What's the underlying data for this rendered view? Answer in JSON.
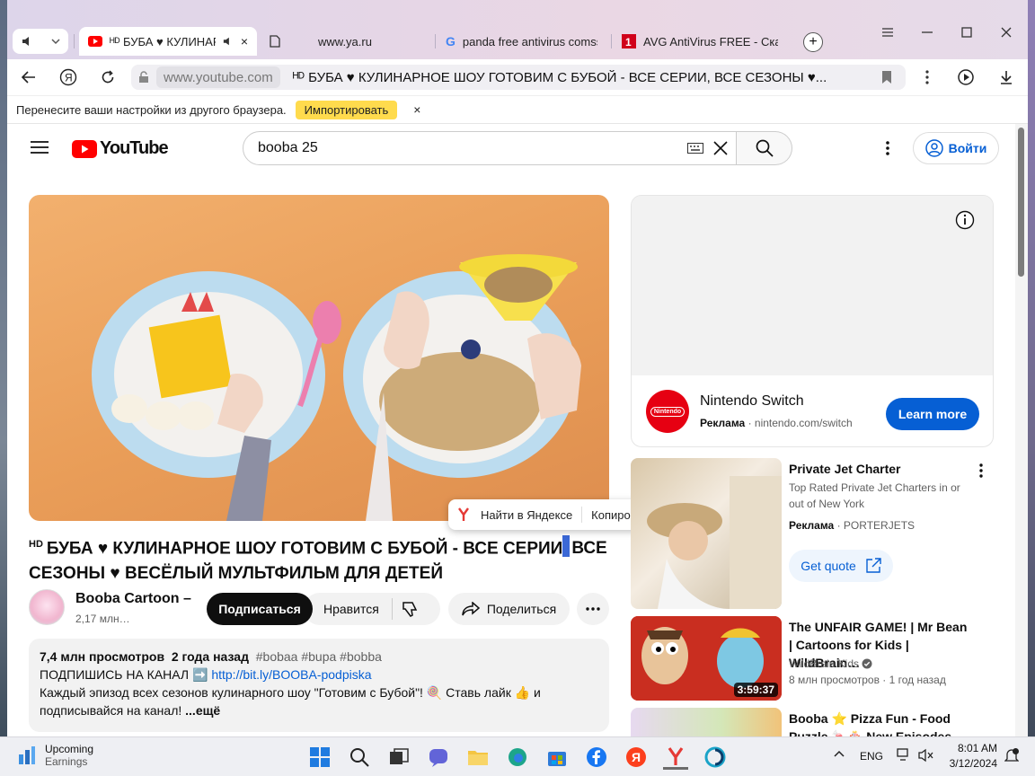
{
  "browser": {
    "tabs": [
      {
        "label": "ᴴᴰ БУБА ♥ КУЛИНАР",
        "favicon": "youtube-icon",
        "active": true
      },
      {
        "label": "www.ya.ru",
        "favicon": "page-icon",
        "active": false
      },
      {
        "label": "panda free antivirus comss",
        "favicon": "google-icon",
        "active": false
      },
      {
        "label": "AVG AntiVirus FREE - Скач",
        "favicon": "avg-icon",
        "active": false
      }
    ],
    "address_domain": "www.youtube.com",
    "address_title": "ᴴᴰ БУБА ♥ КУЛИНАРНОЕ ШОУ ГОТОВИМ С БУБОЙ - ВСЕ СЕРИИ, ВСЕ СЕЗОНЫ ♥...",
    "infobar_text": "Перенесите ваши настройки из другого браузера.",
    "import_label": "Импортировать",
    "close_glyph": "×"
  },
  "youtube": {
    "logo_text": "YouTube",
    "search_query": "booba 25",
    "signin_label": "Войти"
  },
  "video": {
    "hd_badge": "HD",
    "title_part1": "БУБА ♥ КУЛИНАРНОЕ ШОУ ГОТОВИМ С БУБОЙ - ВСЕ СЕРИИ",
    "title_part2": "ВСЕ СЕЗОНЫ ♥ ВЕСЁЛЫЙ МУЛЬТФИЛЬМ ДЛЯ ДЕТЕЙ",
    "selected_char": ","
  },
  "context_popup": {
    "find_label": "Найти в Яндексе",
    "copy_label": "Копировать"
  },
  "channel": {
    "name": "Booba Cartoon –",
    "subs": "2,17 млн…",
    "subscribe_label": "Подписаться",
    "like_label": "Нравится",
    "share_label": "Поделиться"
  },
  "description": {
    "views": "7,4 млн просмотров",
    "age": "2 года назад",
    "tags": "#bobaa #bupa #bobba",
    "line2_prefix": "ПОДПИШИСЬ НА КАНАЛ ➡️",
    "link": "http://bit.ly/BOOBA-podpiska",
    "line3": "Каждый эпизод всех сезонов кулинарного шоу \"Готовим с Бубой\"! 🍭 Ставь лайк 👍 и",
    "line4": "подписывайся на канал!",
    "more_label": "...ещё"
  },
  "ad": {
    "title": "Nintendo Switch",
    "label": "Реклама",
    "url": "nintendo.com/switch",
    "logo_text": "Nintendo",
    "cta": "Learn more"
  },
  "recommendations": [
    {
      "title": "Private Jet Charter",
      "sub1": "Top Rated Private Jet Charters in or out of New York",
      "sub2_label": "Реклама",
      "sub2": "PORTERJETS",
      "cta": "Get quote"
    },
    {
      "title": "The UNFAIR GAME! | Mr Bean | Cartoons for Kids | WildBrain…",
      "channel": "WildBrain Kids",
      "meta": "8 млн просмотров · 1 год назад",
      "duration": "3:59:37"
    },
    {
      "title": "Booba ⭐ Pizza Fun - Food Puzzle 🍬🎂 New Episodes"
    }
  ],
  "taskbar": {
    "widget_title": "Upcoming",
    "widget_sub": "Earnings",
    "lang": "ENG",
    "time": "8:01 AM",
    "date": "3/12/2024"
  },
  "colors": {
    "yt_red": "#ff0000",
    "link_blue": "#065fd4",
    "import_yellow": "#ffdb4d"
  }
}
